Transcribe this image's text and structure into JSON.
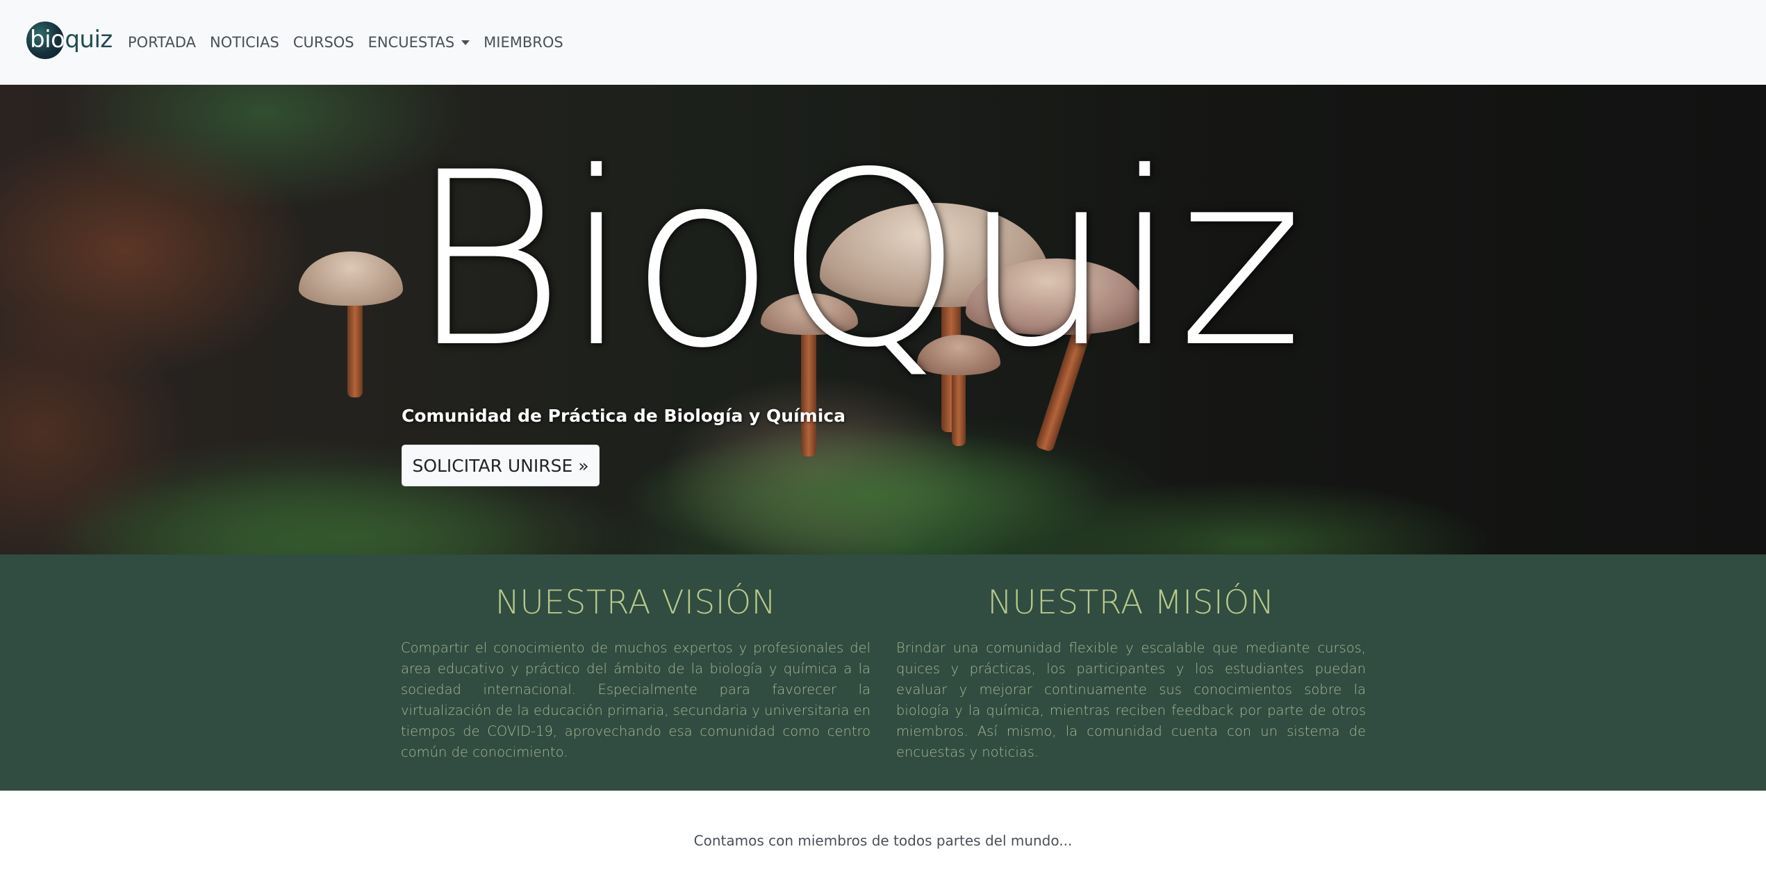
{
  "navbar": {
    "logo_part1": "bio",
    "logo_part2": "quiz",
    "links": [
      "PORTADA",
      "NOTICIAS",
      "CURSOS",
      "ENCUESTAS",
      "MIEMBROS"
    ]
  },
  "hero": {
    "title": "BioQuiz",
    "subtitle": "Comunidad de Práctica de Biología y Química",
    "button_label": "SOLICITAR UNIRSE »"
  },
  "about": {
    "vision": {
      "title": "NUESTRA VISIÓN",
      "text": "Compartir el conocimiento de muchos expertos y profesionales del area educativo y práctico del ámbito de la biología y química a la sociedad internacional. Especialmente para favorecer la virtualización de la educación primaria, secundaria y universitaria en tiempos de COVID-19, aprovechando esa comunidad como centro común de conocimiento."
    },
    "mission": {
      "title": "NUESTRA MISIÓN",
      "text": "Brindar una comunidad flexible y escalable que mediante cursos, quices y prácticas, los participantes y los estudiantes puedan evaluar y mejorar continuamente sus conocimientos sobre la biología y la química, mientras reciben feedback por parte de otros miembros. Así mismo, la comunidad cuenta con un sistema de encuestas y noticias."
    }
  },
  "footer": {
    "members_text": "Contamos con miembros de todos partes del mundo..."
  },
  "colors": {
    "navbar_bg": "#f8f9fa",
    "about_bg": "#314c40",
    "about_heading": "#b7c98c",
    "about_text": "#a6b897"
  }
}
